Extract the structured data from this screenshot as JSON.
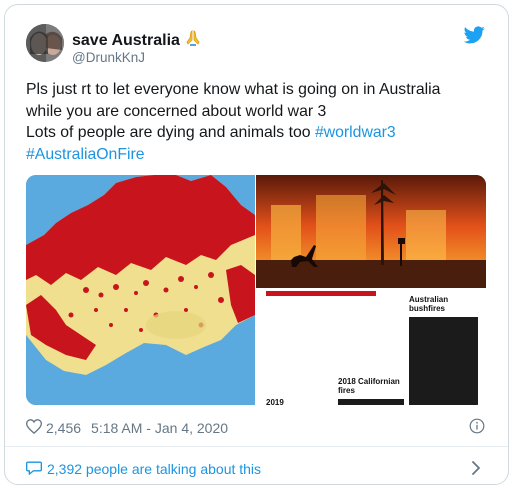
{
  "tweet": {
    "display_name": "save Australia",
    "name_emoji": "🙏",
    "handle": "@DrunkKnJ",
    "text_lines": [
      "Pls just rt to let everyone know what is going on in Australia",
      "while you are concerned about world war 3",
      "Lots of people are dying and animals too "
    ],
    "hashtags": [
      "#worldwar3",
      "#AustraliaOnFire"
    ],
    "likes": "2,456",
    "timestamp": "5:18 AM - Jan 4, 2020",
    "talking_text": "2,392 people are talking about this"
  },
  "media": {
    "graph": {
      "label_australia": "Australian bushfires",
      "label_california": "2018 Californian fires",
      "label_2019": "2019"
    }
  },
  "icons": {
    "bird": "twitter-bird-icon",
    "heart": "heart-icon",
    "info": "info-icon",
    "bubble": "speech-bubble-icon",
    "chevron": "chevron-right-icon"
  },
  "colors": {
    "link": "#1b95e0",
    "muted": "#657786",
    "bird": "#1da1f2",
    "fire_red": "#c8141c",
    "ocean": "#5aa9df",
    "land": "#efdf8e"
  }
}
